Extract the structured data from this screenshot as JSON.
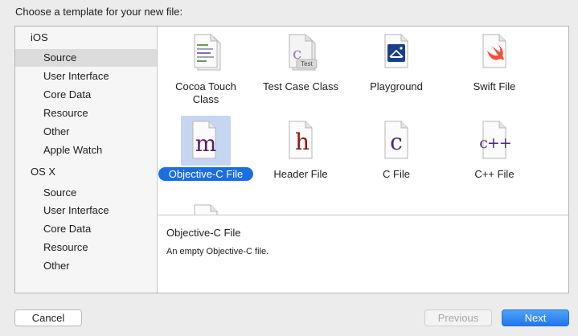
{
  "dialog": {
    "header": "Choose a template for your new file:"
  },
  "sidebar": {
    "groups": [
      {
        "label": "iOS",
        "items": [
          "Source",
          "User Interface",
          "Core Data",
          "Resource",
          "Other",
          "Apple Watch"
        ],
        "selected": "Source"
      },
      {
        "label": "OS X",
        "items": [
          "Source",
          "User Interface",
          "Core Data",
          "Resource",
          "Other"
        ]
      }
    ]
  },
  "templates": [
    {
      "label_line1": "Cocoa Touch",
      "label_line2": "Class",
      "icon": "cocoa-touch-class-icon"
    },
    {
      "label_line1": "Test Case Class",
      "label_line2": "",
      "icon": "test-case-class-icon",
      "badge": "Test"
    },
    {
      "label_line1": "Playground",
      "label_line2": "",
      "icon": "playground-icon"
    },
    {
      "label_line1": "Swift File",
      "label_line2": "",
      "icon": "swift-file-icon"
    },
    {
      "label_line1": "Objective-C File",
      "label_line2": "",
      "icon": "objective-c-file-icon",
      "glyph": "m",
      "selected": true
    },
    {
      "label_line1": "Header File",
      "label_line2": "",
      "icon": "header-file-icon",
      "glyph": "h"
    },
    {
      "label_line1": "C File",
      "label_line2": "",
      "icon": "c-file-icon",
      "glyph": "c"
    },
    {
      "label_line1": "C++ File",
      "label_line2": "",
      "icon": "cpp-file-icon",
      "glyph": "c++"
    }
  ],
  "description": {
    "title": "Objective-C File",
    "text": "An empty Objective-C file."
  },
  "buttons": {
    "cancel": "Cancel",
    "previous": "Previous",
    "next": "Next"
  },
  "colors": {
    "accent": "#1b6ee1",
    "objc_glyph": "#5a1d6e",
    "header_glyph": "#8a1a1a",
    "c_glyph": "#4a2a7a",
    "playground": "#1a3f8c",
    "swift": "#f05138"
  }
}
